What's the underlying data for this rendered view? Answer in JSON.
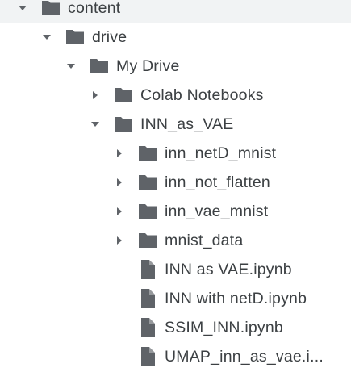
{
  "file_tree": {
    "content": {
      "label": "content",
      "expanded": true,
      "icon": "folder-icon"
    },
    "drive": {
      "label": "drive",
      "expanded": true,
      "icon": "folder-icon"
    },
    "my_drive": {
      "label": "My Drive",
      "expanded": true,
      "icon": "folder-icon"
    },
    "colab_notebooks": {
      "label": "Colab Notebooks",
      "expanded": false,
      "icon": "folder-icon"
    },
    "inn_as_vae": {
      "label": "INN_as_VAE",
      "expanded": true,
      "icon": "folder-icon"
    },
    "inn_netd_mnist": {
      "label": "inn_netD_mnist",
      "expanded": false,
      "icon": "folder-icon"
    },
    "inn_not_flatten": {
      "label": "inn_not_flatten",
      "expanded": false,
      "icon": "folder-icon"
    },
    "inn_vae_mnist": {
      "label": "inn_vae_mnist",
      "expanded": false,
      "icon": "folder-icon"
    },
    "mnist_data": {
      "label": "mnist_data",
      "expanded": false,
      "icon": "folder-icon"
    },
    "inn_as_vae_ipynb": {
      "label": "INN as VAE.ipynb",
      "icon": "file-icon"
    },
    "inn_with_netd_ipynb": {
      "label": "INN with netD.ipynb",
      "icon": "file-icon"
    },
    "ssim_inn_ipynb": {
      "label": "SSIM_INN.ipynb",
      "icon": "file-icon"
    },
    "umap_inn_as_vae": {
      "label": "UMAP_inn_as_vae.i...",
      "icon": "file-icon"
    }
  }
}
